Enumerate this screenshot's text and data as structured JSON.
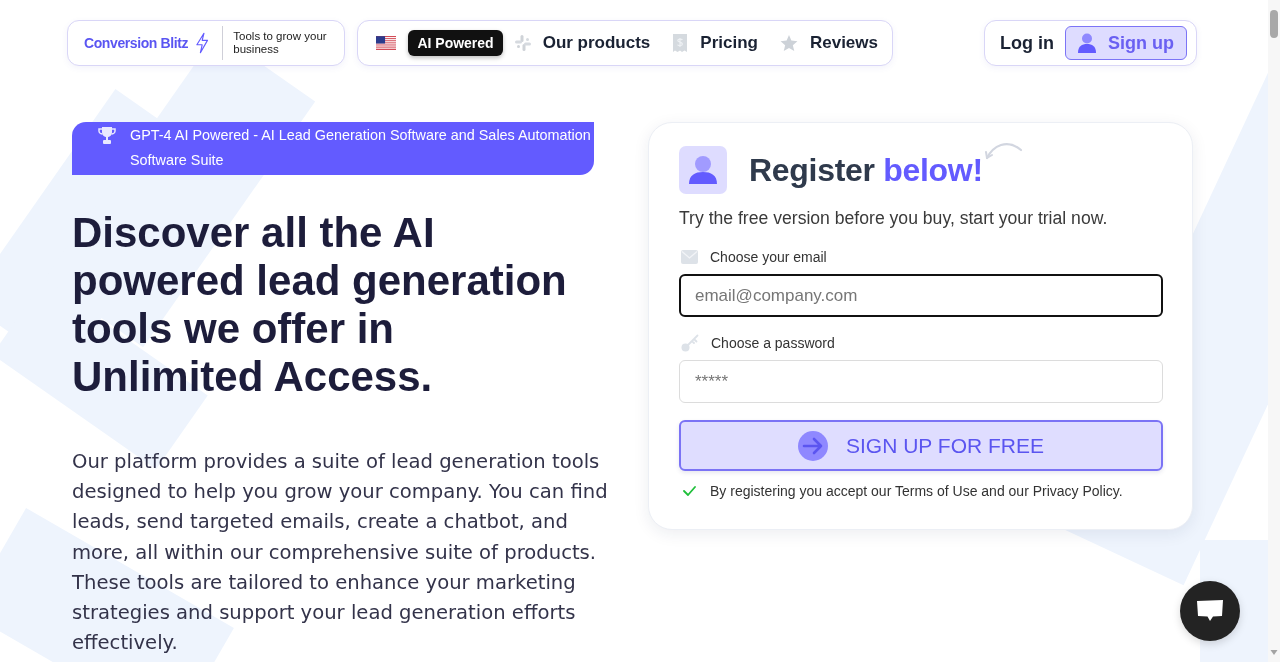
{
  "brand": {
    "name": "Conversion Blitz",
    "tagline": "Tools to grow your business"
  },
  "nav": {
    "badge": "AI Powered",
    "links": [
      {
        "label": "Our products"
      },
      {
        "label": "Pricing"
      },
      {
        "label": "Reviews"
      }
    ]
  },
  "auth": {
    "login": "Log in",
    "signup": "Sign up"
  },
  "hero": {
    "badge": "GPT-4 AI Powered - AI Lead Generation Software and Sales Automation Software Suite",
    "heading": "Discover all the AI powered lead generation tools we offer in Unlimited Access.",
    "description": "Our platform provides a suite of lead generation tools designed to help you grow your company. You can find leads, send targeted emails, create a chatbot, and more, all within our comprehensive suite of products. These tools are tailored to enhance your marketing strategies and support your lead generation efforts effectively."
  },
  "register": {
    "title": "Register",
    "title_highlight": "below!",
    "subtitle": "Try the free version before you buy, start your trial now.",
    "fields": [
      {
        "kind": "email",
        "label": "Choose your email",
        "placeholder": "email@company.com",
        "focused": true
      },
      {
        "kind": "password",
        "label": "Choose a password",
        "placeholder": "*****",
        "focused": false
      }
    ],
    "submit": "SIGN UP FOR FREE",
    "consent": "By registering you accept our Terms of Use and our Privacy Policy."
  }
}
